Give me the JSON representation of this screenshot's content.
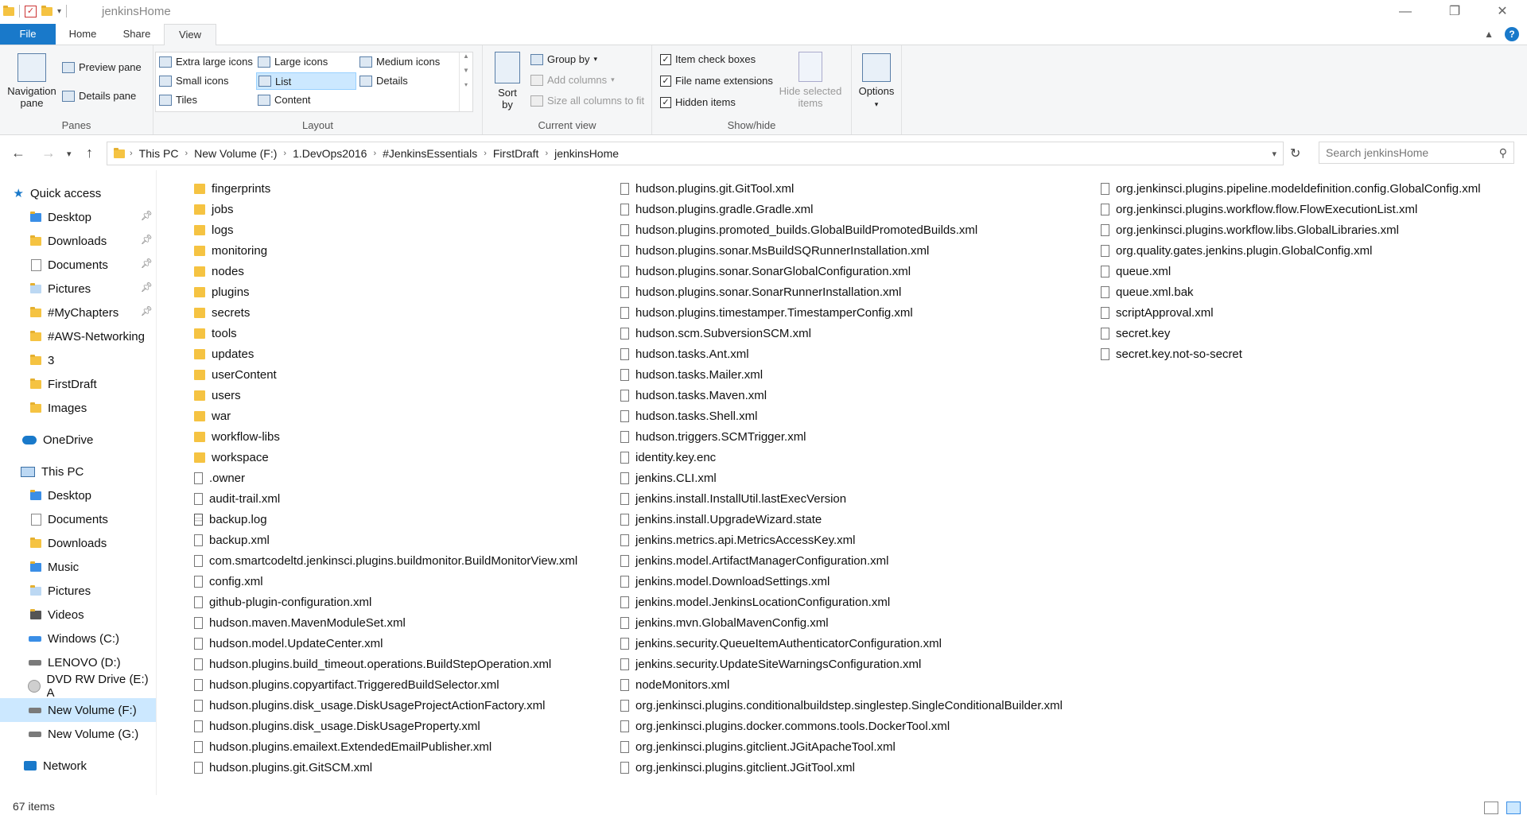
{
  "window": {
    "title": "jenkinsHome",
    "controls": {
      "minimize": "—",
      "maximize": "❐",
      "close": "✕"
    }
  },
  "ribbon": {
    "tabs": [
      {
        "label": "File"
      },
      {
        "label": "Home"
      },
      {
        "label": "Share"
      },
      {
        "label": "View"
      }
    ],
    "panes": {
      "navigation_pane": "Navigation pane",
      "preview_pane": "Preview pane",
      "details_pane": "Details pane",
      "label": "Panes"
    },
    "layout": {
      "options": [
        "Extra large icons",
        "Large icons",
        "Medium icons",
        "Small icons",
        "List",
        "Details",
        "Tiles",
        "Content"
      ],
      "selected": "List",
      "label": "Layout"
    },
    "current_view": {
      "sort_by": "Sort by",
      "group_by": "Group by",
      "add_columns": "Add columns",
      "size_columns": "Size all columns to fit",
      "label": "Current view"
    },
    "show_hide": {
      "item_check_boxes": "Item check boxes",
      "file_name_extensions": "File name extensions",
      "hidden_items": "Hidden items",
      "hide_selected": "Hide selected items",
      "label": "Show/hide"
    },
    "options": "Options"
  },
  "address": {
    "crumbs": [
      "This PC",
      "New Volume (F:)",
      "1.DevOps2016",
      "#JenkinsEssentials",
      "FirstDraft",
      "jenkinsHome"
    ],
    "search_placeholder": "Search jenkinsHome"
  },
  "nav": {
    "quick_access": "Quick access",
    "quick_items": [
      "Desktop",
      "Downloads",
      "Documents",
      "Pictures",
      "#MyChapters",
      "#AWS-Networking",
      "3",
      "FirstDraft",
      "Images"
    ],
    "onedrive": "OneDrive",
    "this_pc": "This PC",
    "pc_items": [
      "Desktop",
      "Documents",
      "Downloads",
      "Music",
      "Pictures",
      "Videos",
      "Windows (C:)",
      "LENOVO (D:)",
      "DVD RW Drive (E:) A",
      "New Volume (F:)",
      "New Volume (G:)"
    ],
    "network": "Network"
  },
  "files": {
    "col1": [
      "fingerprints",
      "jobs",
      "logs",
      "monitoring",
      "nodes",
      "plugins",
      "secrets",
      "tools",
      "updates",
      "userContent",
      "users",
      "war",
      "workflow-libs",
      "workspace",
      ".owner",
      "audit-trail.xml",
      "backup.log",
      "backup.xml",
      "com.smartcodeltd.jenkinsci.plugins.buildmonitor.BuildMonitorView.xml",
      "config.xml",
      "github-plugin-configuration.xml",
      "hudson.maven.MavenModuleSet.xml",
      "hudson.model.UpdateCenter.xml",
      "hudson.plugins.build_timeout.operations.BuildStepOperation.xml",
      "hudson.plugins.copyartifact.TriggeredBuildSelector.xml",
      "hudson.plugins.disk_usage.DiskUsageProjectActionFactory.xml",
      "hudson.plugins.disk_usage.DiskUsageProperty.xml",
      "hudson.plugins.emailext.ExtendedEmailPublisher.xml",
      "hudson.plugins.git.GitSCM.xml"
    ],
    "col2": [
      "hudson.plugins.git.GitTool.xml",
      "hudson.plugins.gradle.Gradle.xml",
      "hudson.plugins.promoted_builds.GlobalBuildPromotedBuilds.xml",
      "hudson.plugins.sonar.MsBuildSQRunnerInstallation.xml",
      "hudson.plugins.sonar.SonarGlobalConfiguration.xml",
      "hudson.plugins.sonar.SonarRunnerInstallation.xml",
      "hudson.plugins.timestamper.TimestamperConfig.xml",
      "hudson.scm.SubversionSCM.xml",
      "hudson.tasks.Ant.xml",
      "hudson.tasks.Mailer.xml",
      "hudson.tasks.Maven.xml",
      "hudson.tasks.Shell.xml",
      "hudson.triggers.SCMTrigger.xml",
      "identity.key.enc",
      "jenkins.CLI.xml",
      "jenkins.install.InstallUtil.lastExecVersion",
      "jenkins.install.UpgradeWizard.state",
      "jenkins.metrics.api.MetricsAccessKey.xml",
      "jenkins.model.ArtifactManagerConfiguration.xml",
      "jenkins.model.DownloadSettings.xml",
      "jenkins.model.JenkinsLocationConfiguration.xml",
      "jenkins.mvn.GlobalMavenConfig.xml",
      "jenkins.security.QueueItemAuthenticatorConfiguration.xml",
      "jenkins.security.UpdateSiteWarningsConfiguration.xml",
      "nodeMonitors.xml",
      "org.jenkinsci.plugins.conditionalbuildstep.singlestep.SingleConditionalBuilder.xml",
      "org.jenkinsci.plugins.docker.commons.tools.DockerTool.xml",
      "org.jenkinsci.plugins.gitclient.JGitApacheTool.xml",
      "org.jenkinsci.plugins.gitclient.JGitTool.xml"
    ],
    "col3": [
      "org.jenkinsci.plugins.pipeline.modeldefinition.config.GlobalConfig.xml",
      "org.jenkinsci.plugins.workflow.flow.FlowExecutionList.xml",
      "org.jenkinsci.plugins.workflow.libs.GlobalLibraries.xml",
      "org.quality.gates.jenkins.plugin.GlobalConfig.xml",
      "queue.xml",
      "queue.xml.bak",
      "scriptApproval.xml",
      "secret.key",
      "secret.key.not-so-secret"
    ]
  },
  "status": {
    "items": "67 items"
  }
}
